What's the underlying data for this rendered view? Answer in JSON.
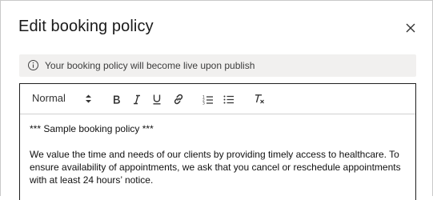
{
  "dialog": {
    "title": "Edit booking policy",
    "close_icon": "close-icon"
  },
  "banner": {
    "icon": "info-icon",
    "message": "Your booking policy will become live upon publish"
  },
  "toolbar": {
    "format_value": "Normal",
    "buttons": [
      "bold-icon",
      "italic-icon",
      "underline-icon",
      "link-icon",
      "ordered-list-icon",
      "bullet-list-icon",
      "clear-format-icon"
    ]
  },
  "editor": {
    "line1": "*** Sample booking policy ***",
    "paragraph": "We value the time and needs of our clients by providing timely access to healthcare. To ensure availability of appointments, we ask that you cancel or reschedule appointments with at least 24 hours’ notice."
  }
}
